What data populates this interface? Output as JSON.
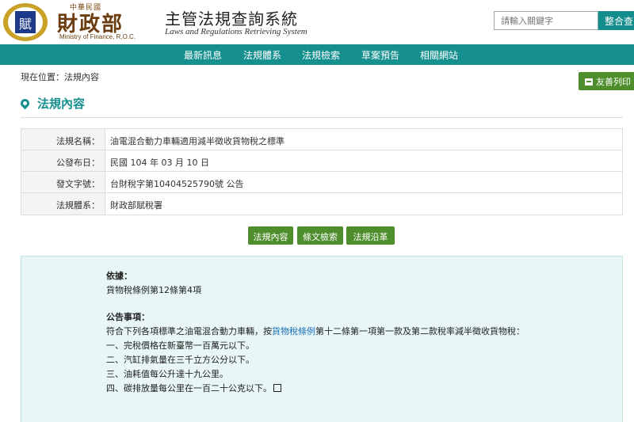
{
  "header": {
    "logo_top": "中華民國",
    "logo_main": "財政部",
    "logo_en": "Ministry of Finance, R.O.C.",
    "system_title": "主管法規查詢系統",
    "system_subtitle": "Laws and Regulations Retrieving System",
    "search_placeholder": "請輸入關鍵字",
    "search_button": "整合查"
  },
  "nav": {
    "items": [
      {
        "label": "最新訊息"
      },
      {
        "label": "法規體系"
      },
      {
        "label": "法規檢索"
      },
      {
        "label": "草案預告"
      },
      {
        "label": "相關網站"
      }
    ]
  },
  "breadcrumb": "現在位置：法規內容",
  "print_button": "友善列印",
  "section_title": "法規內容",
  "info_table": [
    {
      "label": "法規名稱：",
      "value": "油電混合動力車輛適用減半徵收貨物稅之標準"
    },
    {
      "label": "公發布日：",
      "value": "民國 104 年 03 月 10 日"
    },
    {
      "label": "發文字號：",
      "value": "台財稅字第10404525790號 公告"
    },
    {
      "label": "法規體系：",
      "value": "財政部賦稅署"
    }
  ],
  "actions": [
    {
      "label": "法規內容"
    },
    {
      "label": "條文檢索"
    },
    {
      "label": "法規沿革"
    }
  ],
  "content": {
    "basis_title": "依據：",
    "basis_text": "貨物稅條例第12條第4項",
    "notice_title": "公告事項：",
    "notice_intro_pre": "符合下列各項標準之油電混合動力車輛，按",
    "notice_intro_link": "貨物稅條例",
    "notice_intro_post": "第十二條第一項第一款及第二款稅率減半徵收貨物稅：",
    "items": [
      "一、完稅價格在新臺幣一百萬元以下。",
      "二、汽缸排氣量在三千立方公分以下。",
      "三、油耗值每公升達十九公里。",
      "四、碳排放量每公里在一百二十公克以下。"
    ]
  }
}
